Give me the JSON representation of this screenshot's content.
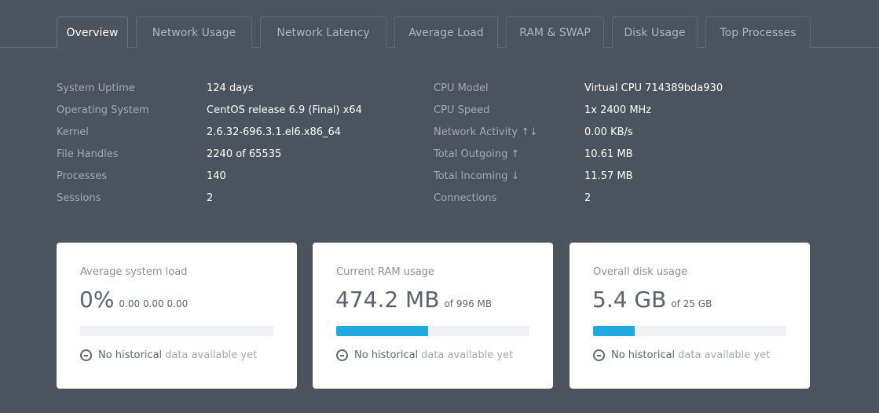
{
  "tabs": [
    {
      "label": "Overview",
      "active": true
    },
    {
      "label": "Network Usage"
    },
    {
      "label": "Network Latency"
    },
    {
      "label": "Average Load"
    },
    {
      "label": "RAM & SWAP"
    },
    {
      "label": "Disk Usage"
    },
    {
      "label": "Top Processes"
    }
  ],
  "info_left": [
    {
      "key": "System Uptime",
      "value": "124 days"
    },
    {
      "key": "Operating System",
      "value": "CentOS release 6.9 (Final) x64"
    },
    {
      "key": "Kernel",
      "value": "2.6.32-696.3.1.el6.x86_64"
    },
    {
      "key": "File Handles",
      "value": "2240 of 65535"
    },
    {
      "key": "Processes",
      "value": "140"
    },
    {
      "key": "Sessions",
      "value": "2"
    }
  ],
  "info_right": [
    {
      "key": "CPU Model",
      "value": "Virtual CPU 714389bda930"
    },
    {
      "key": "CPU Speed",
      "value": "1x 2400 MHz"
    },
    {
      "key": "Network Activity ↑↓",
      "value": "0.00 KB/s"
    },
    {
      "key": "Total Outgoing ↑",
      "value": "10.61 MB"
    },
    {
      "key": "Total Incoming ↓",
      "value": "11.57 MB"
    },
    {
      "key": "Connections",
      "value": "2"
    }
  ],
  "cards": [
    {
      "title": "Average system load",
      "value": "0%",
      "sub": "0.00 0.00 0.00",
      "progress": 0.0,
      "hist_a": "No historical",
      "hist_b": "data available yet"
    },
    {
      "title": "Current RAM usage",
      "value": "474.2 MB",
      "sub": "of 996 MB",
      "progress": 0.476,
      "hist_a": "No historical",
      "hist_b": "data available yet"
    },
    {
      "title": "Overall disk usage",
      "value": "5.4 GB",
      "sub": "of 25 GB",
      "progress": 0.216,
      "hist_a": "No historical",
      "hist_b": "data available yet"
    }
  ],
  "colors": {
    "accent": "#1fa9e1",
    "background": "#4b535e"
  },
  "icons": {
    "history": "minus-circle-icon"
  }
}
